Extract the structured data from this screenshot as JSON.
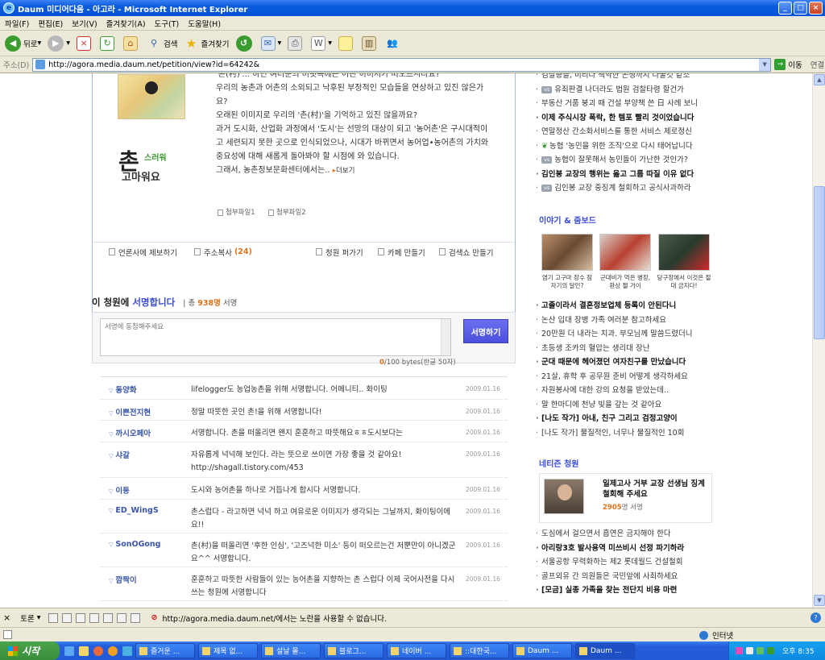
{
  "window": {
    "title": "Daum 미디어다음 - 아고라 - Microsoft Internet Explorer"
  },
  "menu": [
    "파일(F)",
    "편집(E)",
    "보기(V)",
    "즐겨찾기(A)",
    "도구(T)",
    "도움말(H)"
  ],
  "toolbar": {
    "back": "뒤로",
    "search": "검색",
    "favorites": "즐겨찾기"
  },
  "address": {
    "label": "주소(D)",
    "url": "http://agora.media.daum.net/petition/view?id=64242&",
    "go": "이동",
    "links": "연결"
  },
  "petition": {
    "logo_big": "촌",
    "logo_small": "스러워",
    "logo_bottom": "고마워요",
    "lines": [
      "'촌(村)'... 하면 여러분의 머릿속에는 어떤 이미지가 떠오르시나요?",
      "우리의 농촌과 어촌의 소외되고 낙후된 부정적인 모습들을 연상하고 있진 않은가요?",
      "오래된 이미지로 우리의 '촌(村)'을 기억하고 있진 않을까요?",
      "과거 도시화, 산업화 과정에서 '도시'는 선망의 대상이 되고 '농어촌'은 구시대적이고 세련되지 못한 곳으로 인식되었으나, 시대가 바뀌면서 농어업•농어촌의 가치와 중요성에 대해 새롭게 돌아봐야 할 시점에 와 있습니다.",
      "그래서, 농촌정보문화센터에서는.."
    ],
    "more": "더보기",
    "attach1": "첨부파일1",
    "attach2": "첨부파일2",
    "actions": {
      "press": "언론사에 제보하기",
      "copy": "주소복사",
      "copy_count": "(24)",
      "spread": "청원 퍼가기",
      "cafe": "카페 만들기",
      "searchbox": "검색쇼 만들기"
    }
  },
  "sign": {
    "title_pre": "이 청원에 ",
    "title_hl": "서명합니다",
    "total_label": "총 ",
    "total_count": "938명",
    "total_post": " 서명",
    "placeholder": "서명에 동참해주세요",
    "button": "서명하기",
    "byte_count": "0",
    "byte_rest": "/100 bytes(한글 50자)"
  },
  "signatures": [
    {
      "name": "동양화",
      "text": "lifelogger도 농업농촌을 위해 서명합니다. 어메니티.. 화이팅",
      "date": "2009.01.16"
    },
    {
      "name": "이쁜전지현",
      "text": "정말 따뜻한 곳인 촌!을 위해 서명합니다!",
      "date": "2009.01.16"
    },
    {
      "name": "까시오페아",
      "text": "서명합니다. 촌을 떠올리면 왠지 훈훈하고 따뜻해요ㅎㅎ도시보다는",
      "date": "2009.01.16"
    },
    {
      "name": "샤갈",
      "text": "자유롭게 넉넉해 보인다. 라는 뜻으로 쓰이면 가장 좋을 것 같아요! http://shagall.tistory.com/453",
      "date": "2009.01.16"
    },
    {
      "name": "이둥",
      "text": "도시와 농어촌을 하나로 거듭나게 합시다 서명합니다.",
      "date": "2009.01.16"
    },
    {
      "name": "ED_WingS",
      "text": "촌스럽다 - 라고하면 넉넉 하고 여유로운 이미지가 생각되는 그날까지, 화이팅이에요!!",
      "date": "2009.01.16"
    },
    {
      "name": "SonOGong",
      "text": "촌(村)을 떠올리면 '후한 인심', '고즈넉한 미소' 등이 떠오르는건 저뿐만이 아니겠군요^^ 서명합니다.",
      "date": "2009.01.16"
    },
    {
      "name": "깜짝이",
      "text": "훈훈하고 따뜻한 사람들이 있는 농어촌을 지향하는 촌 스럽다 이제 국어사전을 다시쓰는 청원에 서명합니다",
      "date": "2009.01.16"
    }
  ],
  "right": {
    "list1": [
      {
        "text": "검찰총들, 미리다 책약한 논쟁까지 나눌것 같소",
        "bold": false
      },
      {
        "tag": "vs",
        "text": "유죄판결 나더라도 법원 검찰타령 할건가",
        "bold": false
      },
      {
        "text": "부동산 거품 붕괴 때 건설 부양책 쓴 日 사례 보니",
        "bold": false
      },
      {
        "text": "이제 주식시장 폭락, 한 템포 빨리 것이었습니다",
        "bold": true
      },
      {
        "text": "연말정산 간소화서비스를 통한 서비스 제로정신",
        "bold": false
      },
      {
        "leaf": true,
        "text": "농협 '농민을 위한 조직'으로 다시 태어납니다",
        "bold": false
      },
      {
        "tag": "vs",
        "text": "농협이 잘못해서 농민들이 가난한 것인가?",
        "bold": false
      },
      {
        "text": "김인봉 교장의 행위는 옳고 그름 따질 이유 없다",
        "bold": true
      },
      {
        "tag": "vs",
        "text": "김인봉 교장 중징계 철회하고 공식사과하라",
        "bold": false
      }
    ],
    "story_head": "이야기 & 줌보드",
    "photos": [
      {
        "caption": "염기 고구마 장수 잠자기의 달인?"
      },
      {
        "caption": "군대비가 먹은 병장, 환상 젤 거이"
      },
      {
        "caption": "당구장에서 이것은 절대 금지다!"
      }
    ],
    "list2": [
      {
        "text": "고졸이라서 결혼정보업체 등록이 안된다니",
        "bold": true
      },
      {
        "text": "논산 입대 장병 가족 여러분 참고하세요",
        "bold": false
      },
      {
        "text": "20만원 더 내라는 치과. 부모님께 말씀드렸더니",
        "bold": false
      },
      {
        "text": "초등생 조카의 혈압는 생리대 장난",
        "bold": false
      },
      {
        "text": "군대 때문에 헤어졌던 여자친구를 만났습니다",
        "bold": true
      },
      {
        "text": "21살, 휴학 후 공무원 준비 어떻게 생각하세요",
        "bold": false
      },
      {
        "text": "자원봉사에 대한 강의 요청을 받았는데..",
        "bold": false
      },
      {
        "text": "말 한마디에 천냥 빚을 갚는 것 같아요",
        "bold": false
      },
      {
        "text": "[나도 작가] 아내, 친구 그리고 검정고양이",
        "bold": true
      },
      {
        "text": "[나도 작가] 물질적인, 너무나 물질적인 10회",
        "bold": false
      }
    ],
    "netizen_head": "네티즌 청원",
    "netizen": {
      "title": "일제고사 거부 교장 선생님 징계 철회해 주세요",
      "count": "2905",
      "count_suffix": "명 서명"
    },
    "list3": [
      {
        "text": "도심에서 걸으면서 흡연은 금지해야 한다",
        "bold": false
      },
      {
        "text": "아리랑3호 발사용역 미쓰비시 선정 파기하라",
        "bold": true
      },
      {
        "text": "서울공항 무력화하는 제2 롯데월드 건설철회",
        "bold": false
      },
      {
        "text": "골프외유 간 의원들은 국민앞에 사죄하세요",
        "bold": false
      },
      {
        "text": "[모금] 실종 가족을 찾는 전단지 비용 마련",
        "bold": true
      }
    ]
  },
  "findbar": {
    "label": "토론",
    "notice": "http://agora.media.daum.net/에서는 노란을 사용할 수 없습니다."
  },
  "status": {
    "zone": "인터넷"
  },
  "taskbar": {
    "start": "시작",
    "tasks": [
      "즐거운 ...",
      "제목 없...",
      "설날 몰...",
      "블로그...",
      "네이버 ...",
      "::대한국...",
      "Daum ...",
      "Daum ..."
    ],
    "time": "오후 8:35"
  }
}
